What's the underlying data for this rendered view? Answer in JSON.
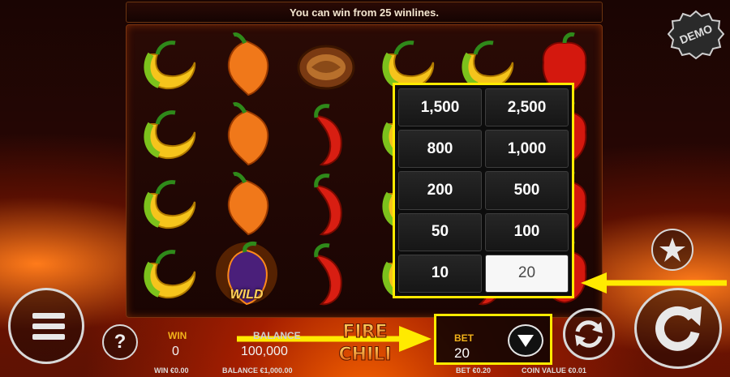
{
  "info_bar": {
    "text": "You can win from 25 winlines."
  },
  "demo_badge": {
    "label": "DEMO"
  },
  "reels": [
    [
      "yellow-chili",
      "yellow-chili",
      "yellow-chili",
      "yellow-chili"
    ],
    [
      "habanero-pepper",
      "habanero-pepper",
      "habanero-pepper",
      "wild-pepper"
    ],
    [
      "walnut",
      "red-chili",
      "red-chili",
      "red-chili"
    ],
    [
      "yellow-chili",
      "yellow-chili",
      "yellow-chili",
      "yellow-chili"
    ],
    [
      "yellow-chili",
      "red-chili",
      "red-chili",
      "red-chili"
    ],
    [
      "red-bell-pepper",
      "red-bell-pepper",
      "red-bell-pepper",
      "red-bell-pepper"
    ]
  ],
  "wild_label": "WILD",
  "bet_options": [
    {
      "value": "1,500",
      "selected": false
    },
    {
      "value": "2,500",
      "selected": false
    },
    {
      "value": "800",
      "selected": false
    },
    {
      "value": "1,000",
      "selected": false
    },
    {
      "value": "200",
      "selected": false
    },
    {
      "value": "500",
      "selected": false
    },
    {
      "value": "50",
      "selected": false
    },
    {
      "value": "100",
      "selected": false
    },
    {
      "value": "10",
      "selected": false
    },
    {
      "value": "20",
      "selected": true
    }
  ],
  "bottom": {
    "win_label": "WIN",
    "win_value": "0",
    "balance_label": "BALANCE",
    "balance_value": "100,000",
    "bet_label": "BET",
    "bet_value": "20",
    "help_label": "?",
    "footer_win": "WIN €0.00",
    "footer_balance": "BALANCE €1,000.00",
    "footer_bet": "BET €0.20",
    "footer_coin": "COIN VALUE €0.01"
  },
  "logo": {
    "line1": "FIRE",
    "line2": "CHILI"
  },
  "colors": {
    "highlight": "#ffea00",
    "label_gold": "#f2b21a",
    "panel_bg": "#0c0c0c"
  }
}
